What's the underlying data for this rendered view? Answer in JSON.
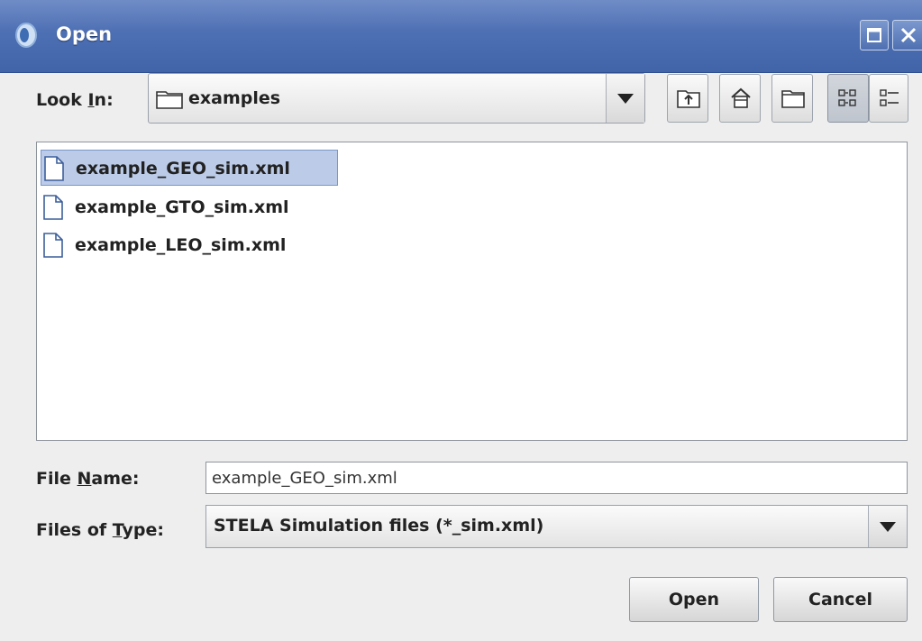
{
  "window": {
    "title": "Open",
    "app_icon": "java-app-icon",
    "maximize_icon": "maximize-icon",
    "close_icon": "close-icon"
  },
  "lookin": {
    "label_pre": "Look ",
    "label_mnemonic": "I",
    "label_post": "n:",
    "value": "examples",
    "tools": [
      "up-one-level-icon",
      "home-icon",
      "new-folder-icon",
      "list-view-icon",
      "details-view-icon"
    ]
  },
  "files": [
    {
      "name": "example_GEO_sim.xml",
      "selected": true
    },
    {
      "name": "example_GTO_sim.xml",
      "selected": false
    },
    {
      "name": "example_LEO_sim.xml",
      "selected": false
    }
  ],
  "filename": {
    "label_pre": "File ",
    "label_mnemonic": "N",
    "label_post": "ame:",
    "value": "example_GEO_sim.xml"
  },
  "filetype": {
    "label_pre": "Files of ",
    "label_mnemonic": "T",
    "label_post": "ype:",
    "value": "STELA Simulation files (*_sim.xml)"
  },
  "buttons": {
    "open": "Open",
    "cancel": "Cancel"
  }
}
